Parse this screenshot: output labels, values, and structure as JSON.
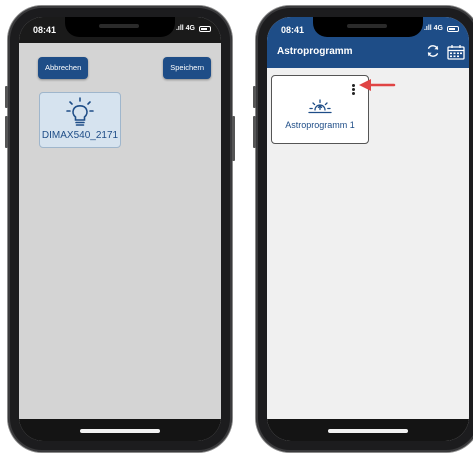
{
  "left_screen": {
    "status_time": "08:41",
    "status_signal": ".ıll 4G",
    "cancel_label": "Abbrechen",
    "save_label": "Speichern",
    "device": {
      "label": "DIMAX540_2171",
      "icon": "light-bulb-icon"
    }
  },
  "right_screen": {
    "status_time": "08:41",
    "status_signal": ".ıll 4G",
    "app_title": "Astroprogramm",
    "toolbar_icons": [
      "refresh-icon",
      "calendar-icon"
    ],
    "program": {
      "label": "Astroprogramm 1",
      "icon": "sunrise-icon",
      "menu_icon": "kebab-menu-icon"
    }
  },
  "colors": {
    "primary": "#1e4d87",
    "left_background": "#d4d4d4",
    "right_background": "#f0f0f0",
    "tile_background": "#d6e3ef",
    "annotation_arrow": "#e04444"
  },
  "annotation": {
    "type": "arrow",
    "points_to": "kebab-menu-icon"
  }
}
